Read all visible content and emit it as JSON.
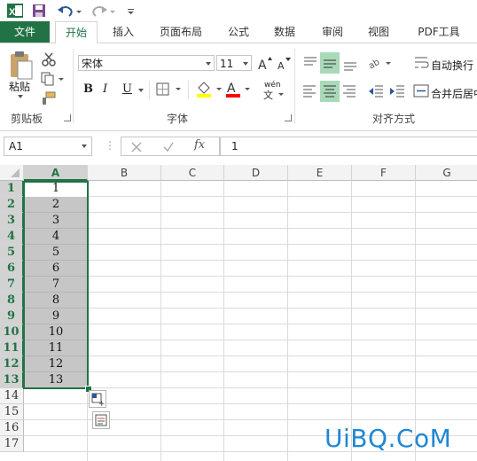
{
  "quick_access": {
    "icons": [
      "excel-logo-icon",
      "save-icon",
      "undo-icon",
      "redo-icon",
      "customize-qat-icon"
    ]
  },
  "tabs": [
    {
      "label": "文件",
      "key": "file"
    },
    {
      "label": "开始",
      "key": "home"
    },
    {
      "label": "插入",
      "key": "insert"
    },
    {
      "label": "页面布局",
      "key": "page-layout"
    },
    {
      "label": "公式",
      "key": "formulas"
    },
    {
      "label": "数据",
      "key": "data"
    },
    {
      "label": "审阅",
      "key": "review"
    },
    {
      "label": "视图",
      "key": "view"
    },
    {
      "label": "PDF工具",
      "key": "pdf"
    }
  ],
  "ribbon": {
    "clipboard": {
      "paste_label": "粘贴",
      "group_label": "剪贴板"
    },
    "font": {
      "font_name": "宋体",
      "font_size": "11",
      "bold": "B",
      "italic": "I",
      "underline": "U",
      "phonetic": "wén",
      "group_label": "字体",
      "fill_color": "#ffff00",
      "font_color": "#ff0000"
    },
    "alignment": {
      "wrap_text": "自动换行",
      "merge_center": "合并后居中",
      "group_label": "对齐方式"
    }
  },
  "formula_bar": {
    "name_box": "A1",
    "value": "1",
    "fx": "fx"
  },
  "sheet": {
    "columns": [
      "A",
      "B",
      "C",
      "D",
      "E",
      "F",
      "G"
    ],
    "rows": [
      "1",
      "2",
      "3",
      "4",
      "5",
      "6",
      "7",
      "8",
      "9",
      "10",
      "11",
      "12",
      "13",
      "14",
      "15",
      "16",
      "17"
    ],
    "column_a_values": [
      "1",
      "2",
      "3",
      "4",
      "5",
      "6",
      "7",
      "8",
      "9",
      "10",
      "11",
      "12",
      "13"
    ],
    "selection_color": "#217346"
  },
  "watermark": "UiBQ.CoM"
}
